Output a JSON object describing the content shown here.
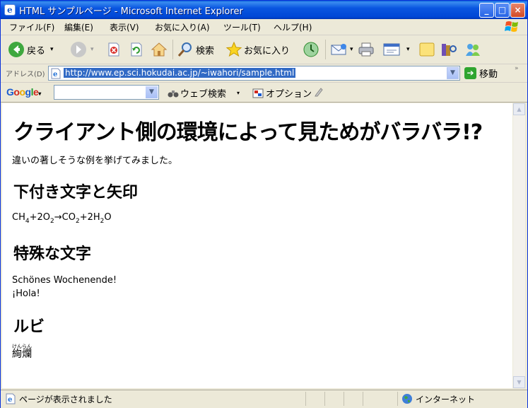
{
  "window": {
    "title": "HTML サンプルページ - Microsoft Internet Explorer",
    "controls": {
      "minimize": "_",
      "maximize": "□",
      "close": "×"
    }
  },
  "menu": {
    "items": [
      "ファイル(F)",
      "編集(E)",
      "表示(V)",
      "お気に入り(A)",
      "ツール(T)",
      "ヘルプ(H)"
    ]
  },
  "toolbar": {
    "back_label": "戻る",
    "search_label": "検索",
    "favorites_label": "お気に入り"
  },
  "address_bar": {
    "label": "アドレス(D)",
    "url": "http://www.ep.sci.hokudai.ac.jp/~iwahori/sample.html",
    "go_label": "移動"
  },
  "google_bar": {
    "logo": "Google",
    "web_search_label": "ウェブ検索",
    "options_label": "オプション"
  },
  "page": {
    "heading": "クライアント側の環境によって見ためがバラバラ!?",
    "intro": "違いの著しそうな例を挙げてみました。",
    "section1_title": "下付き文字と矢印",
    "formula": {
      "ch": "CH",
      "ch_sub": "4",
      "plus_2o": "+2O",
      "o_sub": "2",
      "arrow": "→",
      "co": "CO",
      "co_sub": "2",
      "plus_2h": "+2H",
      "h_sub": "2",
      "o_end": "O"
    },
    "section2_title": "特殊な文字",
    "german": "Schönes Wochenende!",
    "spanish": "¡Hola!",
    "section3_title": "ルビ",
    "ruby_base": "絢爛",
    "ruby_text": "けんらん"
  },
  "status": {
    "text": "ページが表示されました",
    "zone": "インターネット"
  },
  "colors": {
    "title_blue": "#0054e3",
    "selection": "#316ac5"
  }
}
